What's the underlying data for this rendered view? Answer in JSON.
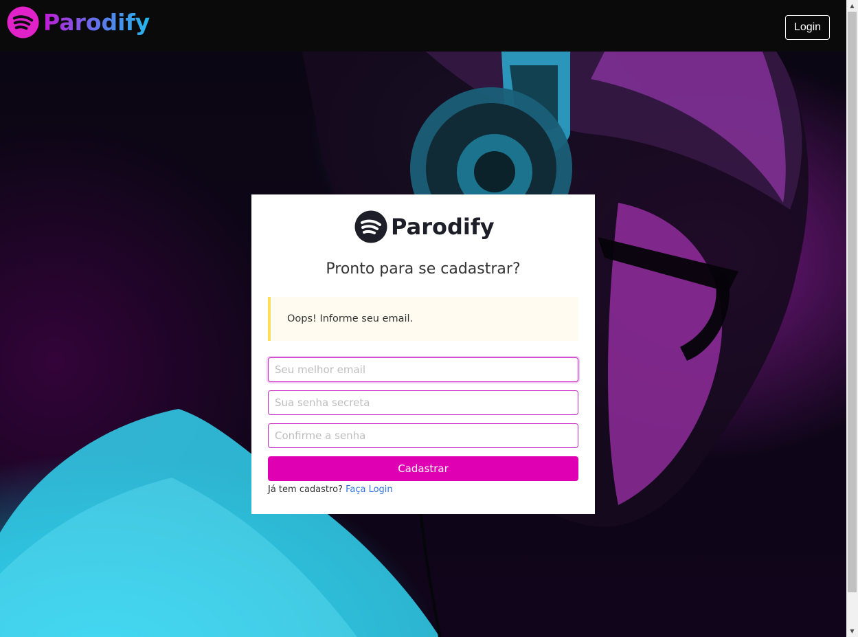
{
  "header": {
    "brand_name": "Parodify",
    "login_label": "Login"
  },
  "signup": {
    "brand_name": "Parodify",
    "title": "Pronto para se cadastrar?",
    "alert_message": "Oops! Informe seu email.",
    "email_placeholder": "Seu melhor email",
    "password_placeholder": "Sua senha secreta",
    "confirm_placeholder": "Confirme a senha",
    "submit_label": "Cadastrar",
    "footer_text": "Já tem cadastro?",
    "footer_link": "Faça Login"
  },
  "colors": {
    "accent": "#e000b4",
    "navbar_bg": "#0a0a0a",
    "alert_border": "#ffdd57",
    "link": "#3273dc"
  },
  "icons": {
    "brand_logo": "parodify-sound-waves-icon"
  }
}
